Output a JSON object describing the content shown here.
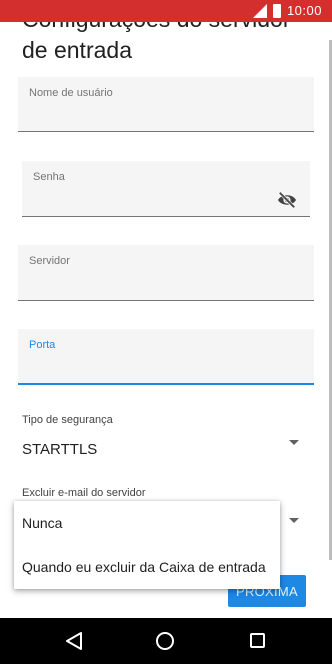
{
  "status_bar": {
    "time": "10:00"
  },
  "header": {
    "title": "Configurações do servidor de entrada"
  },
  "form": {
    "username": {
      "label": "Nome de usuário",
      "value": ""
    },
    "password": {
      "label": "Senha",
      "value": ""
    },
    "server": {
      "label": "Servidor",
      "value": ""
    },
    "port": {
      "label": "Porta",
      "value": ""
    },
    "security": {
      "label": "Tipo de segurança",
      "value": "STARTTLS"
    },
    "delete_email": {
      "label": "Excluir e-mail do servidor"
    }
  },
  "dropdown": {
    "options": [
      "Nunca",
      "Quando eu excluir da Caixa de entrada"
    ]
  },
  "actions": {
    "next_label": "PRÓXIMA"
  },
  "colors": {
    "status_bar": "#d32f2f",
    "accent": "#1e88e5",
    "field_bg": "#f5f5f5"
  },
  "icons": [
    "signal-icon",
    "battery-icon",
    "visibility-off-icon",
    "dropdown-arrow-icon",
    "back-icon",
    "home-icon",
    "recents-icon"
  ]
}
